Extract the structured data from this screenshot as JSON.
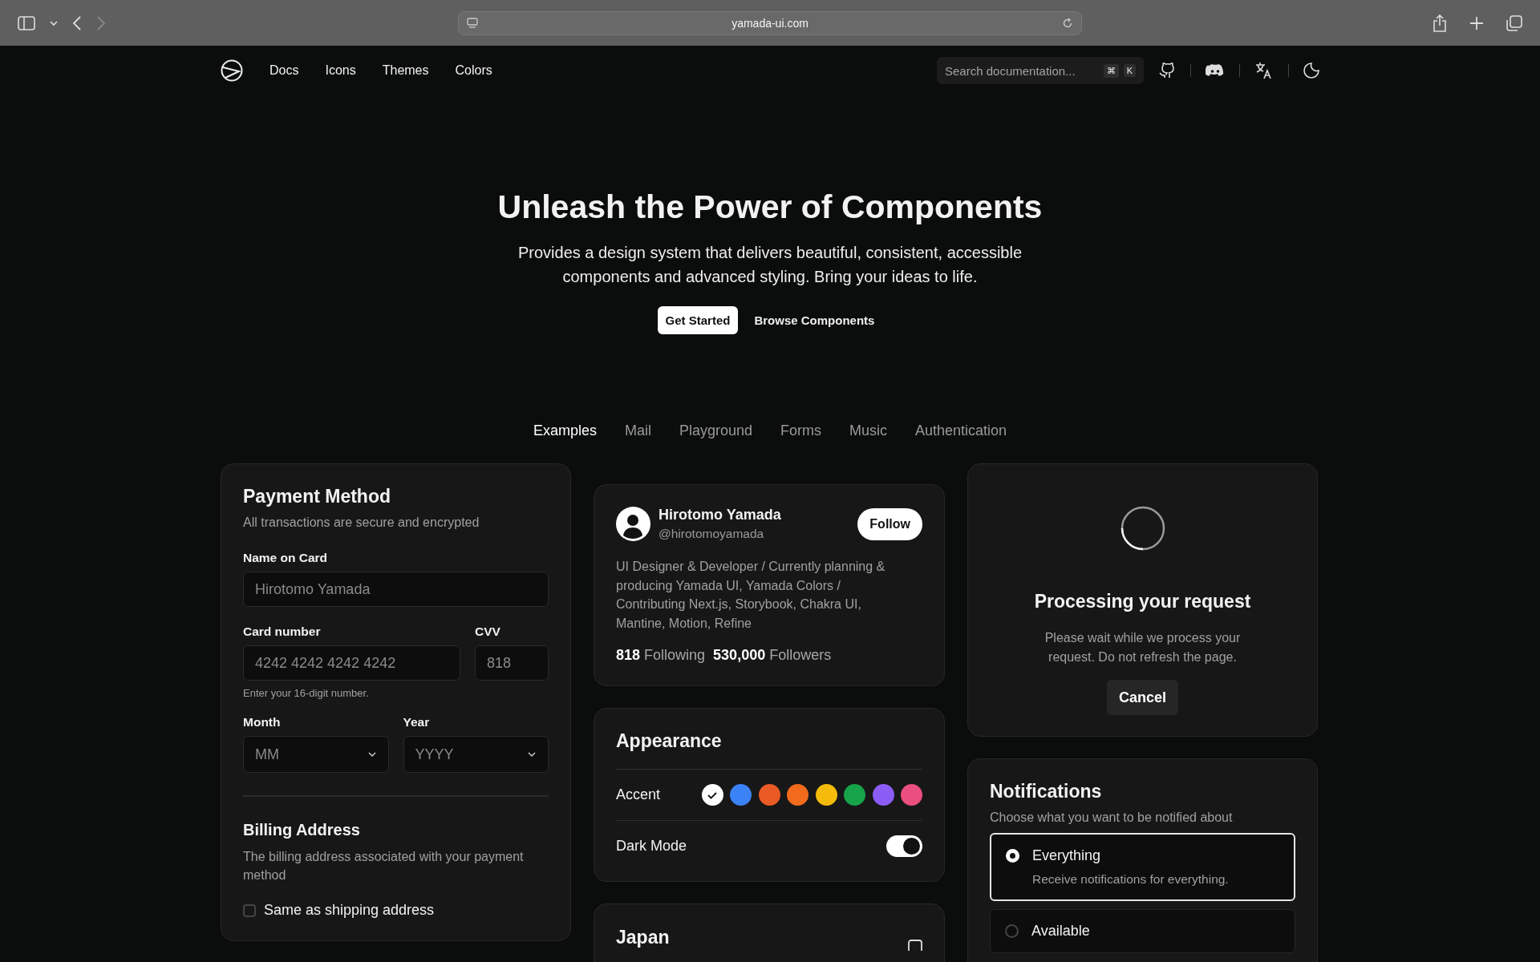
{
  "browser": {
    "url": "yamada-ui.com"
  },
  "nav": {
    "links": [
      "Docs",
      "Icons",
      "Themes",
      "Colors"
    ],
    "search": {
      "placeholder": "Search documentation...",
      "keys": [
        "⌘",
        "K"
      ]
    }
  },
  "hero": {
    "title": "Unleash the Power of Components",
    "subtitle": "Provides a design system that delivers beautiful, consistent, accessible components and advanced styling. Bring your ideas to life.",
    "buttons": [
      {
        "label": "Get Started",
        "kind": "primary"
      },
      {
        "label": "Browse Components",
        "kind": "ghost"
      }
    ]
  },
  "tabs": [
    {
      "label": "Examples",
      "selected": true
    },
    {
      "label": "Mail",
      "selected": false
    },
    {
      "label": "Playground",
      "selected": false
    },
    {
      "label": "Forms",
      "selected": false
    },
    {
      "label": "Music",
      "selected": false
    },
    {
      "label": "Authentication",
      "selected": false
    }
  ],
  "payment": {
    "title": "Payment Method",
    "subtitle": "All transactions are secure and encrypted",
    "name_label": "Name on Card",
    "name_placeholder": "Hirotomo Yamada",
    "card_label": "Card number",
    "card_placeholder": "4242 4242 4242 4242",
    "card_hint": "Enter your 16-digit number.",
    "cvv_label": "CVV",
    "cvv_placeholder": "818",
    "month_label": "Month",
    "month_placeholder": "MM",
    "year_label": "Year",
    "year_placeholder": "YYYY",
    "billing_title": "Billing Address",
    "billing_subtitle": "The billing address associated with your payment method",
    "same_as_shipping": {
      "label": "Same as shipping address",
      "checked": false
    }
  },
  "profile": {
    "name": "Hirotomo Yamada",
    "handle": "@hirotomoyamada",
    "follow_button": "Follow",
    "bio": "UI Designer & Developer / Currently planning & producing Yamada UI, Yamada Colors / Contributing Next.js, Storybook, Chakra UI, Mantine, Motion, Refine",
    "following_count": "818",
    "following_label": "Following",
    "followers_count": "530,000",
    "followers_label": "Followers"
  },
  "appearance": {
    "title": "Appearance",
    "accent_label": "Accent",
    "accents": [
      {
        "color": "#ffffff",
        "selected": true
      },
      {
        "color": "#3b82f6",
        "selected": false
      },
      {
        "color": "#ea5a25",
        "selected": false
      },
      {
        "color": "#f26b1d",
        "selected": false
      },
      {
        "color": "#f5bb0b",
        "selected": false
      },
      {
        "color": "#16a34a",
        "selected": false
      },
      {
        "color": "#8b5cf6",
        "selected": false
      },
      {
        "color": "#eb4f7f",
        "selected": false
      }
    ],
    "dark_mode": {
      "label": "Dark Mode",
      "on": true
    }
  },
  "japan": {
    "title": "Japan"
  },
  "processing": {
    "title": "Processing your request",
    "message": "Please wait while we process your request. Do not refresh the page.",
    "cancel": "Cancel"
  },
  "notifications": {
    "title": "Notifications",
    "subtitle": "Choose what you want to be notified about",
    "options": [
      {
        "label": "Everything",
        "description": "Receive notifications for everything.",
        "selected": true
      },
      {
        "label": "Available",
        "selected": false
      }
    ]
  }
}
